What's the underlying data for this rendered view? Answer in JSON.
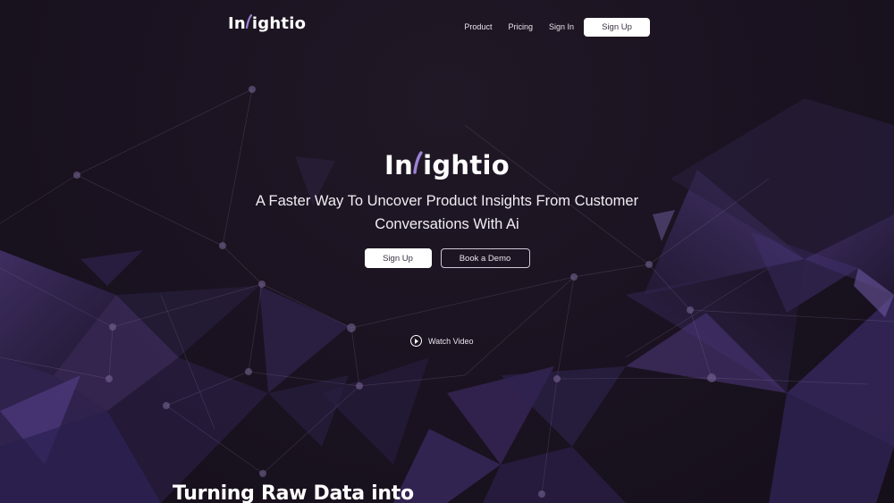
{
  "brand": {
    "name_prefix": "In",
    "name_suffix": "ightio"
  },
  "nav": {
    "links": [
      "Product",
      "Pricing",
      "Sign In"
    ],
    "signup_label": "Sign Up"
  },
  "hero": {
    "subtitle_line1": "A Faster Way To Uncover Product Insights From Customer",
    "subtitle_line2": "Conversations With Ai",
    "primary_button": "Sign Up",
    "secondary_button": "Book a Demo",
    "watch_video": "Watch Video"
  },
  "section": {
    "heading": "Turning Raw Data into"
  },
  "colors": {
    "background": "#1b1320",
    "accent_purple": "#4a3677",
    "button_bg": "#ffffff"
  },
  "icons": {
    "logo_mark": "fingerprint-swoosh-icon",
    "watch_video": "play-circle-icon"
  }
}
